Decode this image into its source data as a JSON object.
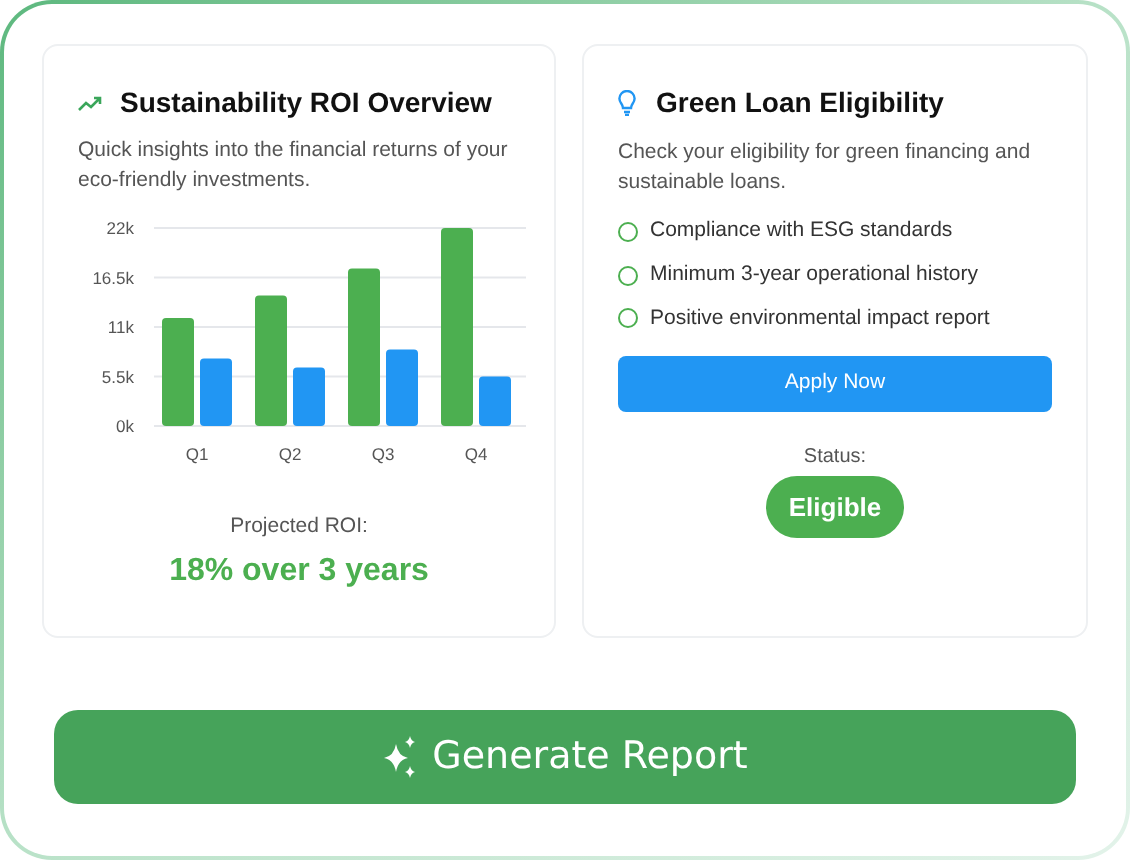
{
  "roi_card": {
    "title": "Sustainability ROI Overview",
    "description": "Quick insights into the financial returns of your eco-friendly investments.",
    "chart_data": {
      "type": "bar",
      "categories": [
        "Q1",
        "Q2",
        "Q3",
        "Q4"
      ],
      "yticks": [
        {
          "value": 0,
          "label": "0k"
        },
        {
          "value": 5500,
          "label": "5.5k"
        },
        {
          "value": 11000,
          "label": "11k"
        },
        {
          "value": 16500,
          "label": "16.5k"
        },
        {
          "value": 22000,
          "label": "22k"
        }
      ],
      "ylim": [
        0,
        22000
      ],
      "grid": true,
      "series": [
        {
          "color": "#4caf50",
          "values": [
            12000,
            14500,
            17500,
            22000
          ]
        },
        {
          "color": "#2196f3",
          "values": [
            7500,
            6500,
            8500,
            5500
          ]
        }
      ]
    },
    "projection_label": "Projected ROI:",
    "projection_value": "18% over 3 years"
  },
  "loan_card": {
    "title": "Green Loan Eligibility",
    "description": "Check your eligibility for green financing and sustainable loans.",
    "criteria": [
      {
        "label": "Compliance with ESG standards",
        "checked": false
      },
      {
        "label": "Minimum 3-year operational history",
        "checked": false
      },
      {
        "label": "Positive environmental impact report",
        "checked": false
      }
    ],
    "apply_button": "Apply Now",
    "status_label": "Status:",
    "status_value": "Eligible"
  },
  "generate_button": "Generate Report"
}
